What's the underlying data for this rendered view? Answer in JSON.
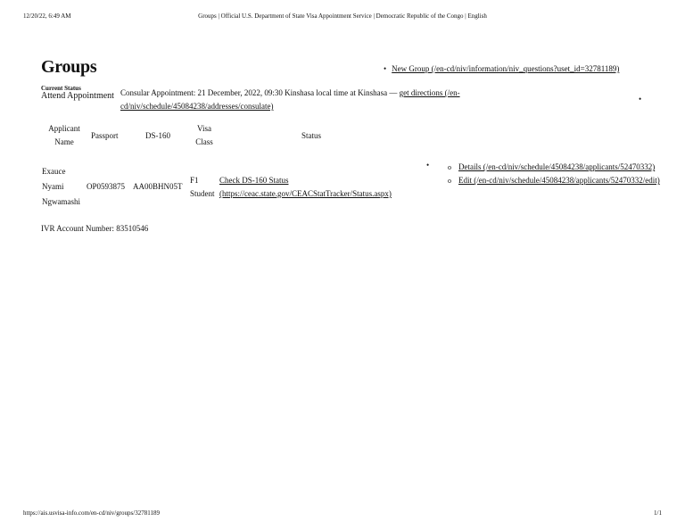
{
  "print_header": {
    "datetime": "12/20/22, 6:49 AM",
    "doc_title": "Groups | Official U.S. Department of State Visa Appointment Service | Democratic Republic of the Congo | English"
  },
  "page": {
    "title": "Groups",
    "new_group_link": "New Group (/en-cd/niv/information/niv_questions?uset_id=32781189)"
  },
  "status": {
    "label": "Current Status",
    "value": "Attend Appointment",
    "appointment_text": "Consular Appointment: 21 December, 2022, 09:30 Kinshasa local time at Kinshasa — ",
    "directions_link": "get directions (/en-cd/niv/schedule/45084238/addresses/consulate)"
  },
  "table": {
    "headers": {
      "applicant": "Applicant Name",
      "passport": "Passport",
      "ds160": "DS-160",
      "visa_class": "Visa Class",
      "status": "Status"
    },
    "row": {
      "name_first": "Exauce",
      "name_middle": "Nyami",
      "name_last": "Ngwamashi",
      "passport": "OP0593875",
      "ds160": "AA00BHN05T",
      "visa_class_code": "F1",
      "visa_class_label": "Student",
      "check_status_link": "Check DS-160 Status",
      "ceac_link": "(https://ceac.state.gov/CEACStatTracker/Status.aspx)",
      "details_link": "Details (/en-cd/niv/schedule/45084238/applicants/52470332)",
      "edit_link": "Edit (/en-cd/niv/schedule/45084238/applicants/52470332/edit)"
    }
  },
  "ivr": {
    "text": "IVR Account Number: 83510546"
  },
  "print_footer": {
    "url": "https://ais.usvisa-info.com/en-cd/niv/groups/32781189",
    "page": "1/1"
  },
  "glyphs": {
    "bullet": "•",
    "circle": "o"
  }
}
